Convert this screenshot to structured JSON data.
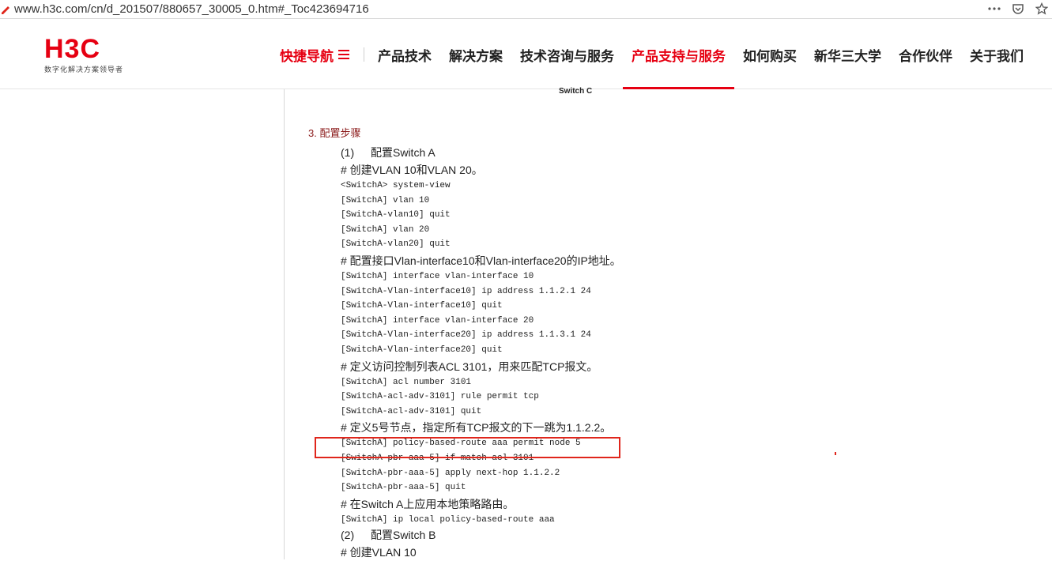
{
  "browser": {
    "url": "www.h3c.com/cn/d_201507/880657_30005_0.htm#_Toc423694716"
  },
  "header": {
    "logo_text": "H3C",
    "logo_tagline": "数字化解决方案领导者",
    "quick_nav_label": "快捷导航",
    "nav_items": [
      {
        "label": "产品技术",
        "active": false
      },
      {
        "label": "解决方案",
        "active": false
      },
      {
        "label": "技术咨询与服务",
        "active": false
      },
      {
        "label": "产品支持与服务",
        "active": true
      },
      {
        "label": "如何购买",
        "active": false
      },
      {
        "label": "新华三大学",
        "active": false
      },
      {
        "label": "合作伙伴",
        "active": false
      },
      {
        "label": "关于我们",
        "active": false
      }
    ]
  },
  "content": {
    "figure_caption": "Switch C",
    "section_title": "3. 配置步骤",
    "lines": [
      {
        "type": "step",
        "num": "(1)",
        "text": "配置Switch A"
      },
      {
        "type": "comment",
        "text": "# 创建VLAN 10和VLAN 20。"
      },
      {
        "type": "code",
        "text": "<SwitchA> system-view"
      },
      {
        "type": "code",
        "text": "[SwitchA] vlan 10"
      },
      {
        "type": "code",
        "text": "[SwitchA-vlan10] quit"
      },
      {
        "type": "code",
        "text": "[SwitchA] vlan 20"
      },
      {
        "type": "code",
        "text": "[SwitchA-vlan20] quit"
      },
      {
        "type": "comment",
        "text": "# 配置接口Vlan-interface10和Vlan-interface20的IP地址。"
      },
      {
        "type": "code",
        "text": "[SwitchA] interface vlan-interface 10"
      },
      {
        "type": "code",
        "text": "[SwitchA-Vlan-interface10] ip address 1.1.2.1 24"
      },
      {
        "type": "code",
        "text": "[SwitchA-Vlan-interface10] quit"
      },
      {
        "type": "code",
        "text": "[SwitchA] interface vlan-interface 20"
      },
      {
        "type": "code",
        "text": "[SwitchA-Vlan-interface20] ip address 1.1.3.1 24"
      },
      {
        "type": "code",
        "text": "[SwitchA-Vlan-interface20] quit"
      },
      {
        "type": "comment",
        "text": "# 定义访问控制列表ACL 3101，用来匹配TCP报文。"
      },
      {
        "type": "code",
        "text": "[SwitchA] acl number 3101"
      },
      {
        "type": "code",
        "text": "[SwitchA-acl-adv-3101] rule permit tcp"
      },
      {
        "type": "code",
        "text": "[SwitchA-acl-adv-3101] quit"
      },
      {
        "type": "comment",
        "text": "# 定义5号节点，指定所有TCP报文的下一跳为1.1.2.2。"
      },
      {
        "type": "code",
        "text": "[SwitchA] policy-based-route aaa permit node 5"
      },
      {
        "type": "code",
        "text": "[SwitchA-pbr-aaa-5] if-match acl 3101"
      },
      {
        "type": "code",
        "text": "[SwitchA-pbr-aaa-5] apply next-hop 1.1.2.2"
      },
      {
        "type": "code",
        "text": "[SwitchA-pbr-aaa-5] quit"
      },
      {
        "type": "comment",
        "text": "# 在Switch A上应用本地策略路由。"
      },
      {
        "type": "code",
        "text": "[SwitchA] ip local policy-based-route aaa"
      },
      {
        "type": "step",
        "num": "(2)",
        "text": "配置Switch B"
      },
      {
        "type": "comment",
        "text": "# 创建VLAN 10"
      }
    ]
  },
  "colors": {
    "brand_red": "#e60012",
    "highlight_red": "#e0261c",
    "section_title": "#8b1a1a"
  }
}
